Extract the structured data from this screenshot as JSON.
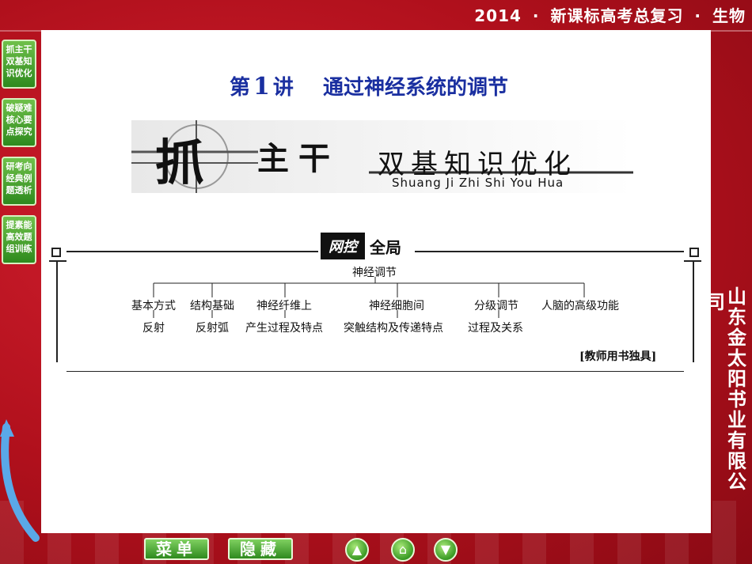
{
  "header": {
    "year": "2014",
    "sep1": "·",
    "series": "新课标高考总复习",
    "sep2": "·",
    "subject": "生物"
  },
  "sidebar": {
    "items": [
      {
        "label": "抓主干双基知识优化"
      },
      {
        "label": "破疑难核心要点探究"
      },
      {
        "label": "研考向经典例题透析"
      },
      {
        "label": "提素能高效题组训练"
      }
    ]
  },
  "lecture": {
    "prefix": "第",
    "number": "1",
    "suffix": "讲",
    "title": "通过神经系统的调节"
  },
  "banner": {
    "big_char": "抓",
    "main": "主干",
    "sub": "双基知识优化",
    "pinyin": "Shuang Ji Zhi Shi You Hua"
  },
  "panel": {
    "tag": "网控",
    "word": "全局",
    "root": "神经调节",
    "branches": [
      {
        "top": "基本方式",
        "bottom": "反射"
      },
      {
        "top": "结构基础",
        "bottom": "反射弧"
      },
      {
        "top": "神经纤维上",
        "bottom": "产生过程及特点"
      },
      {
        "top": "神经细胞间",
        "bottom": "突触结构及传递特点"
      },
      {
        "top": "分级调节",
        "bottom": "过程及关系"
      },
      {
        "top": "人脑的高级功能",
        "bottom": ""
      }
    ],
    "teacher_note": "[教师用书独具]"
  },
  "company": {
    "fragment": "司",
    "name": "山东金太阳书业有限公"
  },
  "bottom": {
    "menu_label": "菜单",
    "hide_label": "隐藏"
  }
}
